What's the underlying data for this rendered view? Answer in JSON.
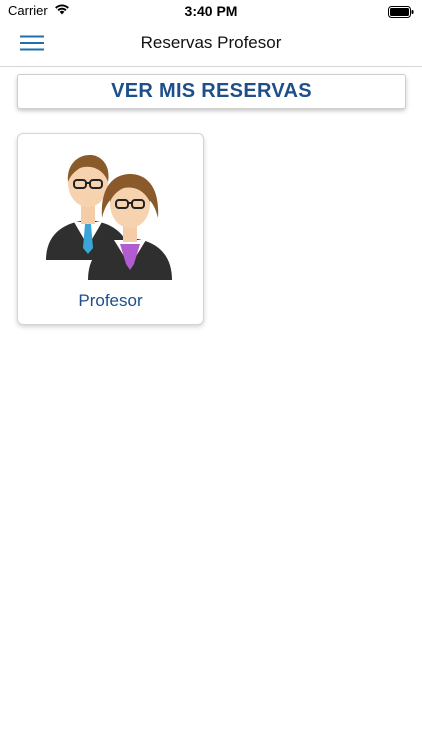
{
  "status": {
    "carrier": "Carrier",
    "time": "3:40 PM"
  },
  "nav": {
    "title": "Reservas Profesor",
    "menu_icon": "hamburger-menu-icon"
  },
  "actions": {
    "ver_mis_reservas": "VER MIS RESERVAS"
  },
  "cards": [
    {
      "label": "Profesor",
      "icon": "teachers-illustration"
    }
  ],
  "colors": {
    "accent": "#1e4f8a",
    "menu_icon": "#1f6fae"
  }
}
